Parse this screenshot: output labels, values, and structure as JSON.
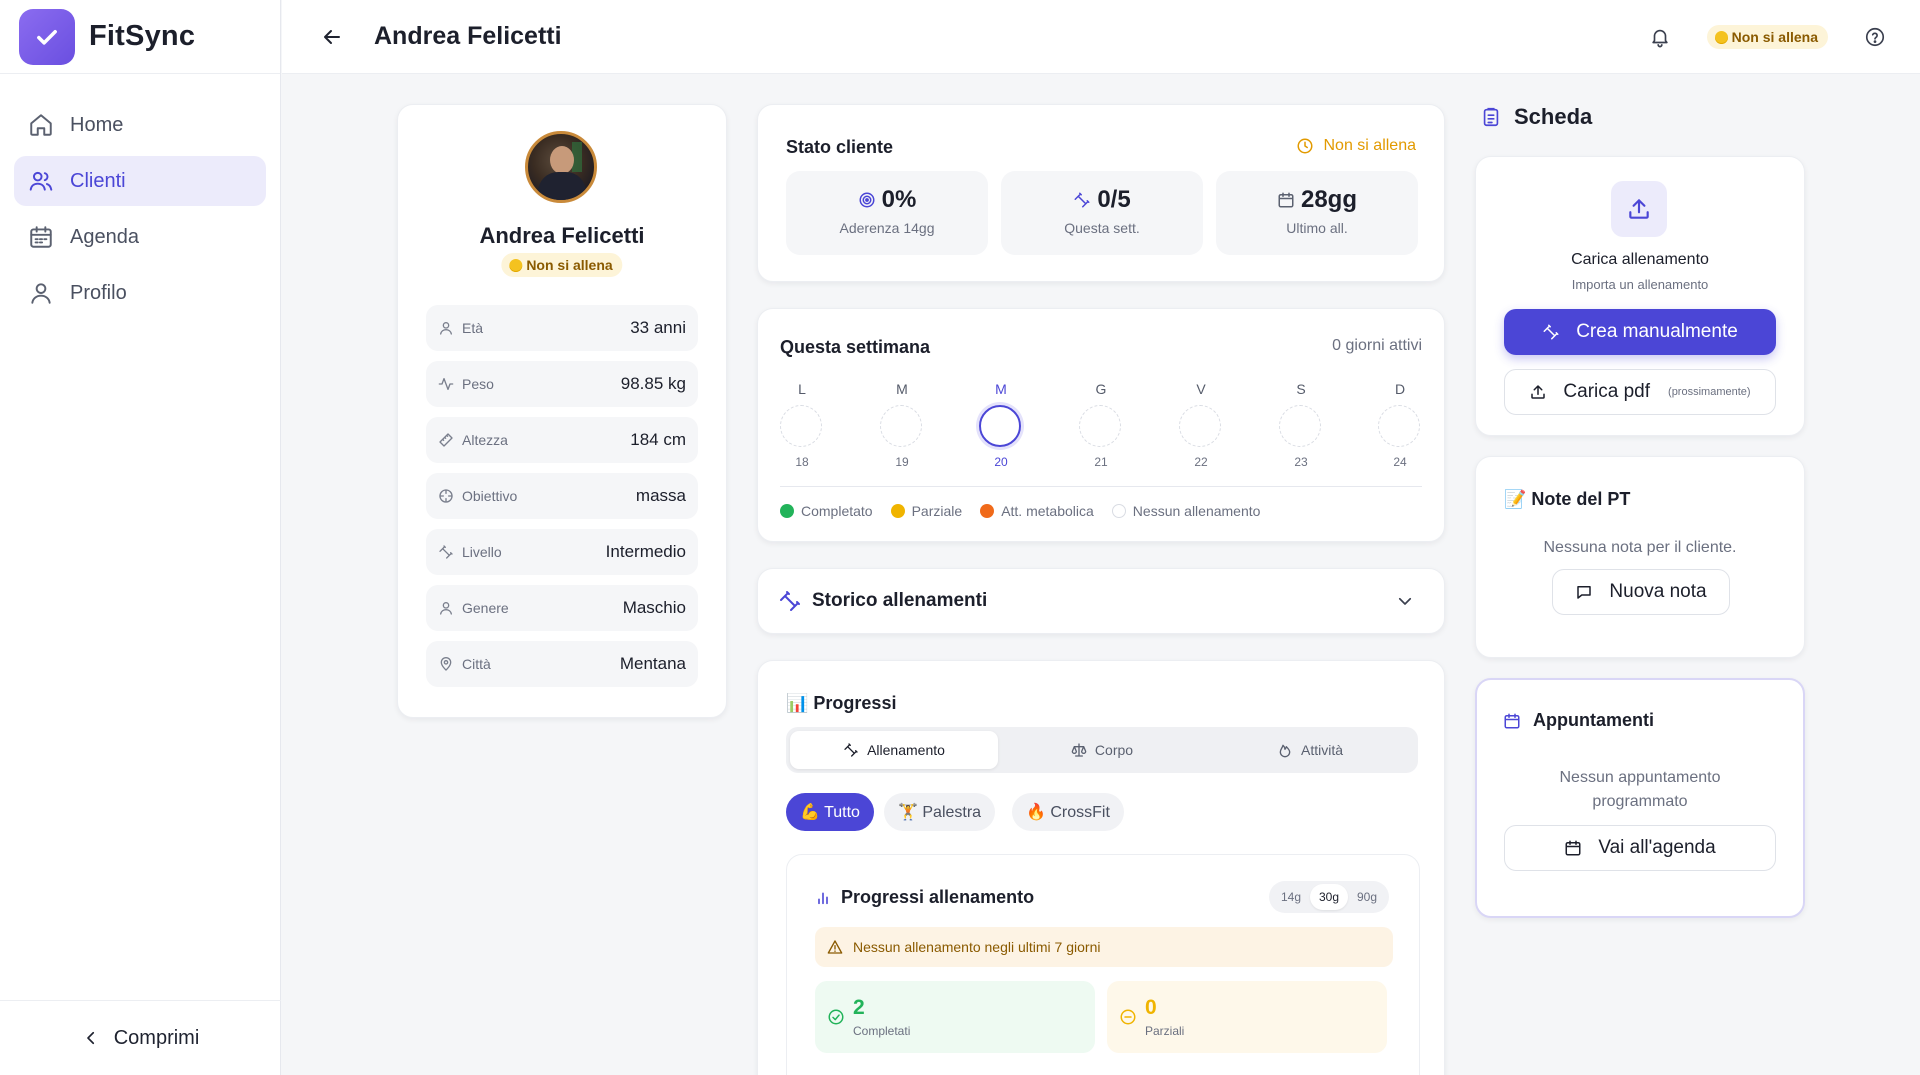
{
  "app": {
    "name": "FitSync"
  },
  "sidebar": {
    "items": [
      {
        "label": "Home",
        "icon": "home-icon"
      },
      {
        "label": "Clienti",
        "icon": "users-icon"
      },
      {
        "label": "Agenda",
        "icon": "calendar-icon"
      },
      {
        "label": "Profilo",
        "icon": "user-icon"
      }
    ],
    "collapse_label": "Comprimi"
  },
  "header": {
    "title": "Andrea Felicetti",
    "status_label": "Non si allena"
  },
  "profile": {
    "name": "Andrea Felicetti",
    "status_label": "Non si allena",
    "fields": [
      {
        "label": "Età",
        "value": "33 anni"
      },
      {
        "label": "Peso",
        "value": "98.85 kg"
      },
      {
        "label": "Altezza",
        "value": "184 cm"
      },
      {
        "label": "Obiettivo",
        "value": "massa"
      },
      {
        "label": "Livello",
        "value": "Intermedio"
      },
      {
        "label": "Genere",
        "value": "Maschio"
      },
      {
        "label": "Città",
        "value": "Mentana"
      }
    ]
  },
  "stato": {
    "title": "Stato cliente",
    "status": "Non si allena",
    "stats": [
      {
        "value": "0%",
        "label": "Aderenza 14gg",
        "icon": "target-icon"
      },
      {
        "value": "0/5",
        "label": "Questa sett.",
        "icon": "dumbbell-icon"
      },
      {
        "value": "28gg",
        "label": "Ultimo all.",
        "icon": "calendar-icon"
      }
    ]
  },
  "week": {
    "title": "Questa settimana",
    "active": "0 giorni attivi",
    "days": [
      {
        "letter": "L",
        "num": "18"
      },
      {
        "letter": "M",
        "num": "19"
      },
      {
        "letter": "M",
        "num": "20",
        "today": true
      },
      {
        "letter": "G",
        "num": "21"
      },
      {
        "letter": "V",
        "num": "22"
      },
      {
        "letter": "S",
        "num": "23"
      },
      {
        "letter": "D",
        "num": "24"
      }
    ],
    "legend": [
      {
        "label": "Completato",
        "color": "#22b35a"
      },
      {
        "label": "Parziale",
        "color": "#f0b400"
      },
      {
        "label": "Att. metabolica",
        "color": "#f06a1a"
      },
      {
        "label": "Nessun allenamento",
        "color": "#ffffff"
      }
    ]
  },
  "storico": {
    "title": "Storico allenamenti"
  },
  "progressi": {
    "title": "📊 Progressi",
    "tabs": [
      "Allenamento",
      "Corpo",
      "Attività"
    ],
    "chips": [
      "💪 Tutto",
      "🏋️ Palestra",
      "🔥 CrossFit"
    ],
    "chart_title": "Progressi allenamento",
    "ranges": [
      "14g",
      "30g",
      "90g"
    ],
    "warning": "Nessun allenamento negli ultimi 7 giorni",
    "completati": {
      "value": "2",
      "label": "Completati"
    },
    "parziali": {
      "value": "0",
      "label": "Parziali"
    }
  },
  "scheda": {
    "title": "Scheda",
    "upload_title": "Carica allenamento",
    "upload_sub": "Importa un allenamento",
    "create_btn": "Crea manualmente",
    "pdf_btn": "Carica pdf",
    "pdf_note": "(prossimamente)"
  },
  "note": {
    "title": "📝 Note del PT",
    "empty": "Nessuna nota per il cliente.",
    "new_btn": "Nuova nota"
  },
  "appuntamenti": {
    "title": "Appuntamenti",
    "empty_line1": "Nessun appuntamento",
    "empty_line2": "programmato",
    "agenda_btn": "Vai all'agenda"
  },
  "colors": {
    "accent": "#4b46d6",
    "status_bg": "#fdf4d8",
    "success": "#22b35a",
    "warning": "#f0b400"
  }
}
